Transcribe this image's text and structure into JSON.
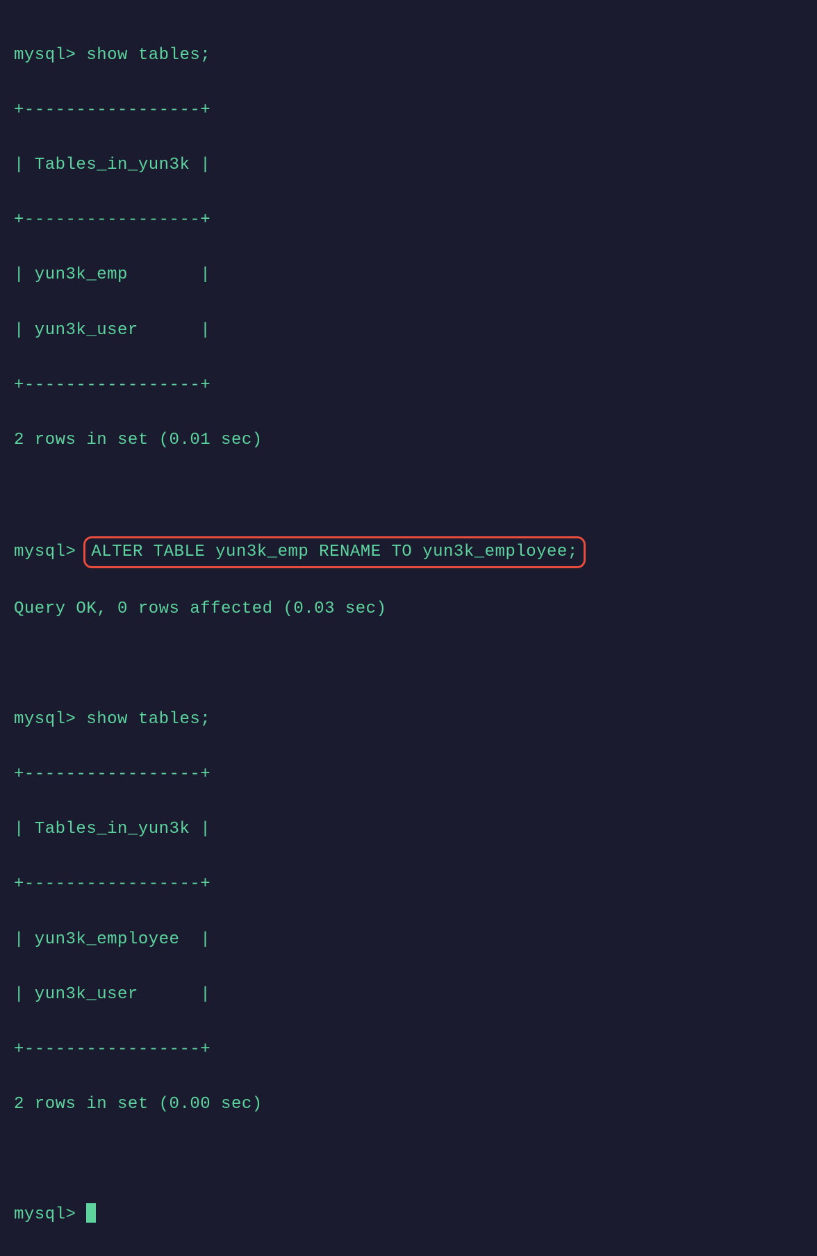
{
  "session": {
    "prompt": "mysql>",
    "commands": {
      "show_tables_1": "show tables;",
      "alter_table": "ALTER TABLE yun3k_emp RENAME TO yun3k_employee;",
      "show_tables_2": "show tables;"
    },
    "tables_result_1": {
      "border_top": "+-----------------+",
      "header": "| Tables_in_yun3k |",
      "border_mid": "+-----------------+",
      "rows": [
        "| yun3k_emp       |",
        "| yun3k_user      |"
      ],
      "border_bottom": "+-----------------+",
      "summary": "2 rows in set (0.01 sec)"
    },
    "alter_result": "Query OK, 0 rows affected (0.03 sec)",
    "tables_result_2": {
      "border_top": "+-----------------+",
      "header": "| Tables_in_yun3k |",
      "border_mid": "+-----------------+",
      "rows": [
        "| yun3k_employee  |",
        "| yun3k_user      |"
      ],
      "border_bottom": "+-----------------+",
      "summary": "2 rows in set (0.00 sec)"
    }
  }
}
